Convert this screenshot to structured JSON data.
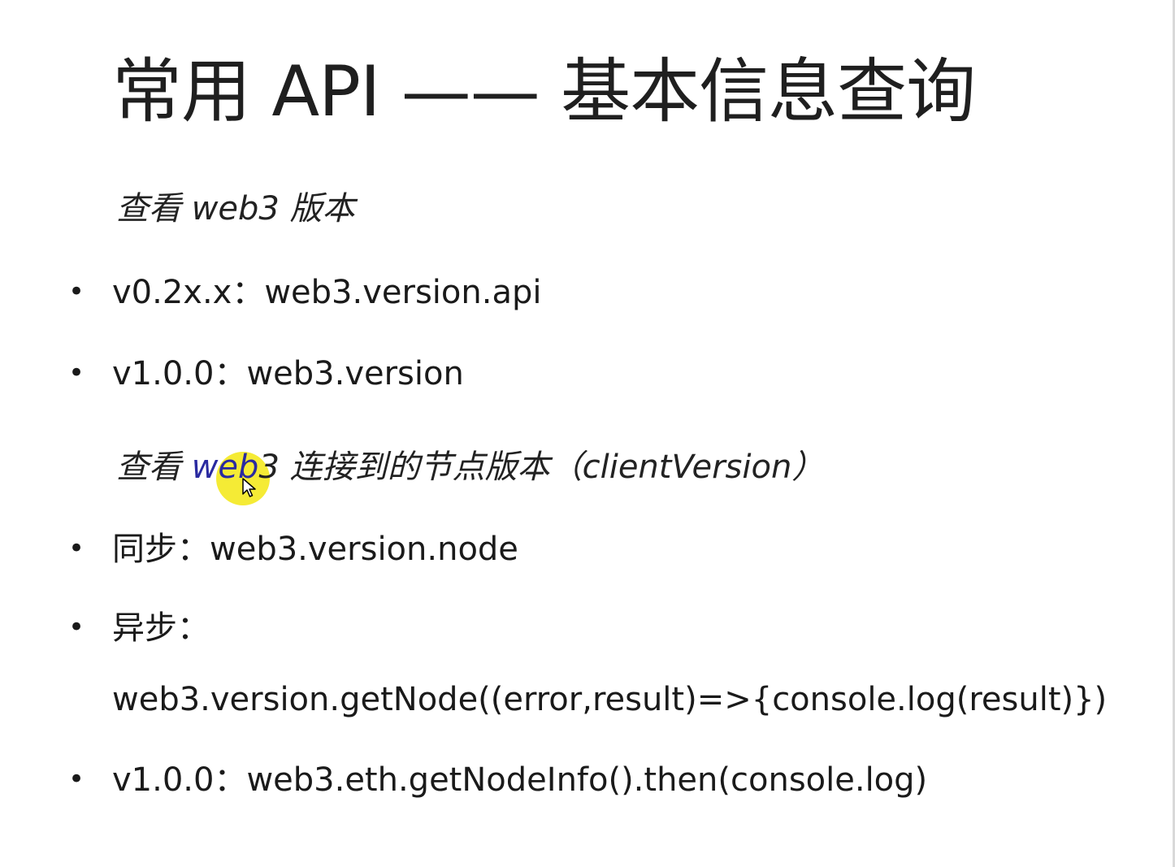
{
  "slide": {
    "title": "常用 API —— 基本信息查询",
    "section1": {
      "heading": "查看 web3 版本",
      "items": [
        {
          "text": "v0.2x.x：web3.version.api"
        },
        {
          "text": "v1.0.0：web3.version"
        }
      ]
    },
    "section2": {
      "heading_before": "查看 ",
      "heading_highlight": "web",
      "heading_after": "3 连接到的节点版本（clientVersion）",
      "items": [
        {
          "text": "同步：web3.version.node"
        },
        {
          "text": "异步："
        },
        {
          "text": "web3.version.getNode((error,result)=>{console.log(result)})"
        },
        {
          "text": "v1.0.0：web3.eth.getNodeInfo().then(console.log)"
        }
      ]
    },
    "bullet_char": "•",
    "colors": {
      "pointer_highlight": "#f4ea2a",
      "text": "#1a1a1a"
    }
  }
}
